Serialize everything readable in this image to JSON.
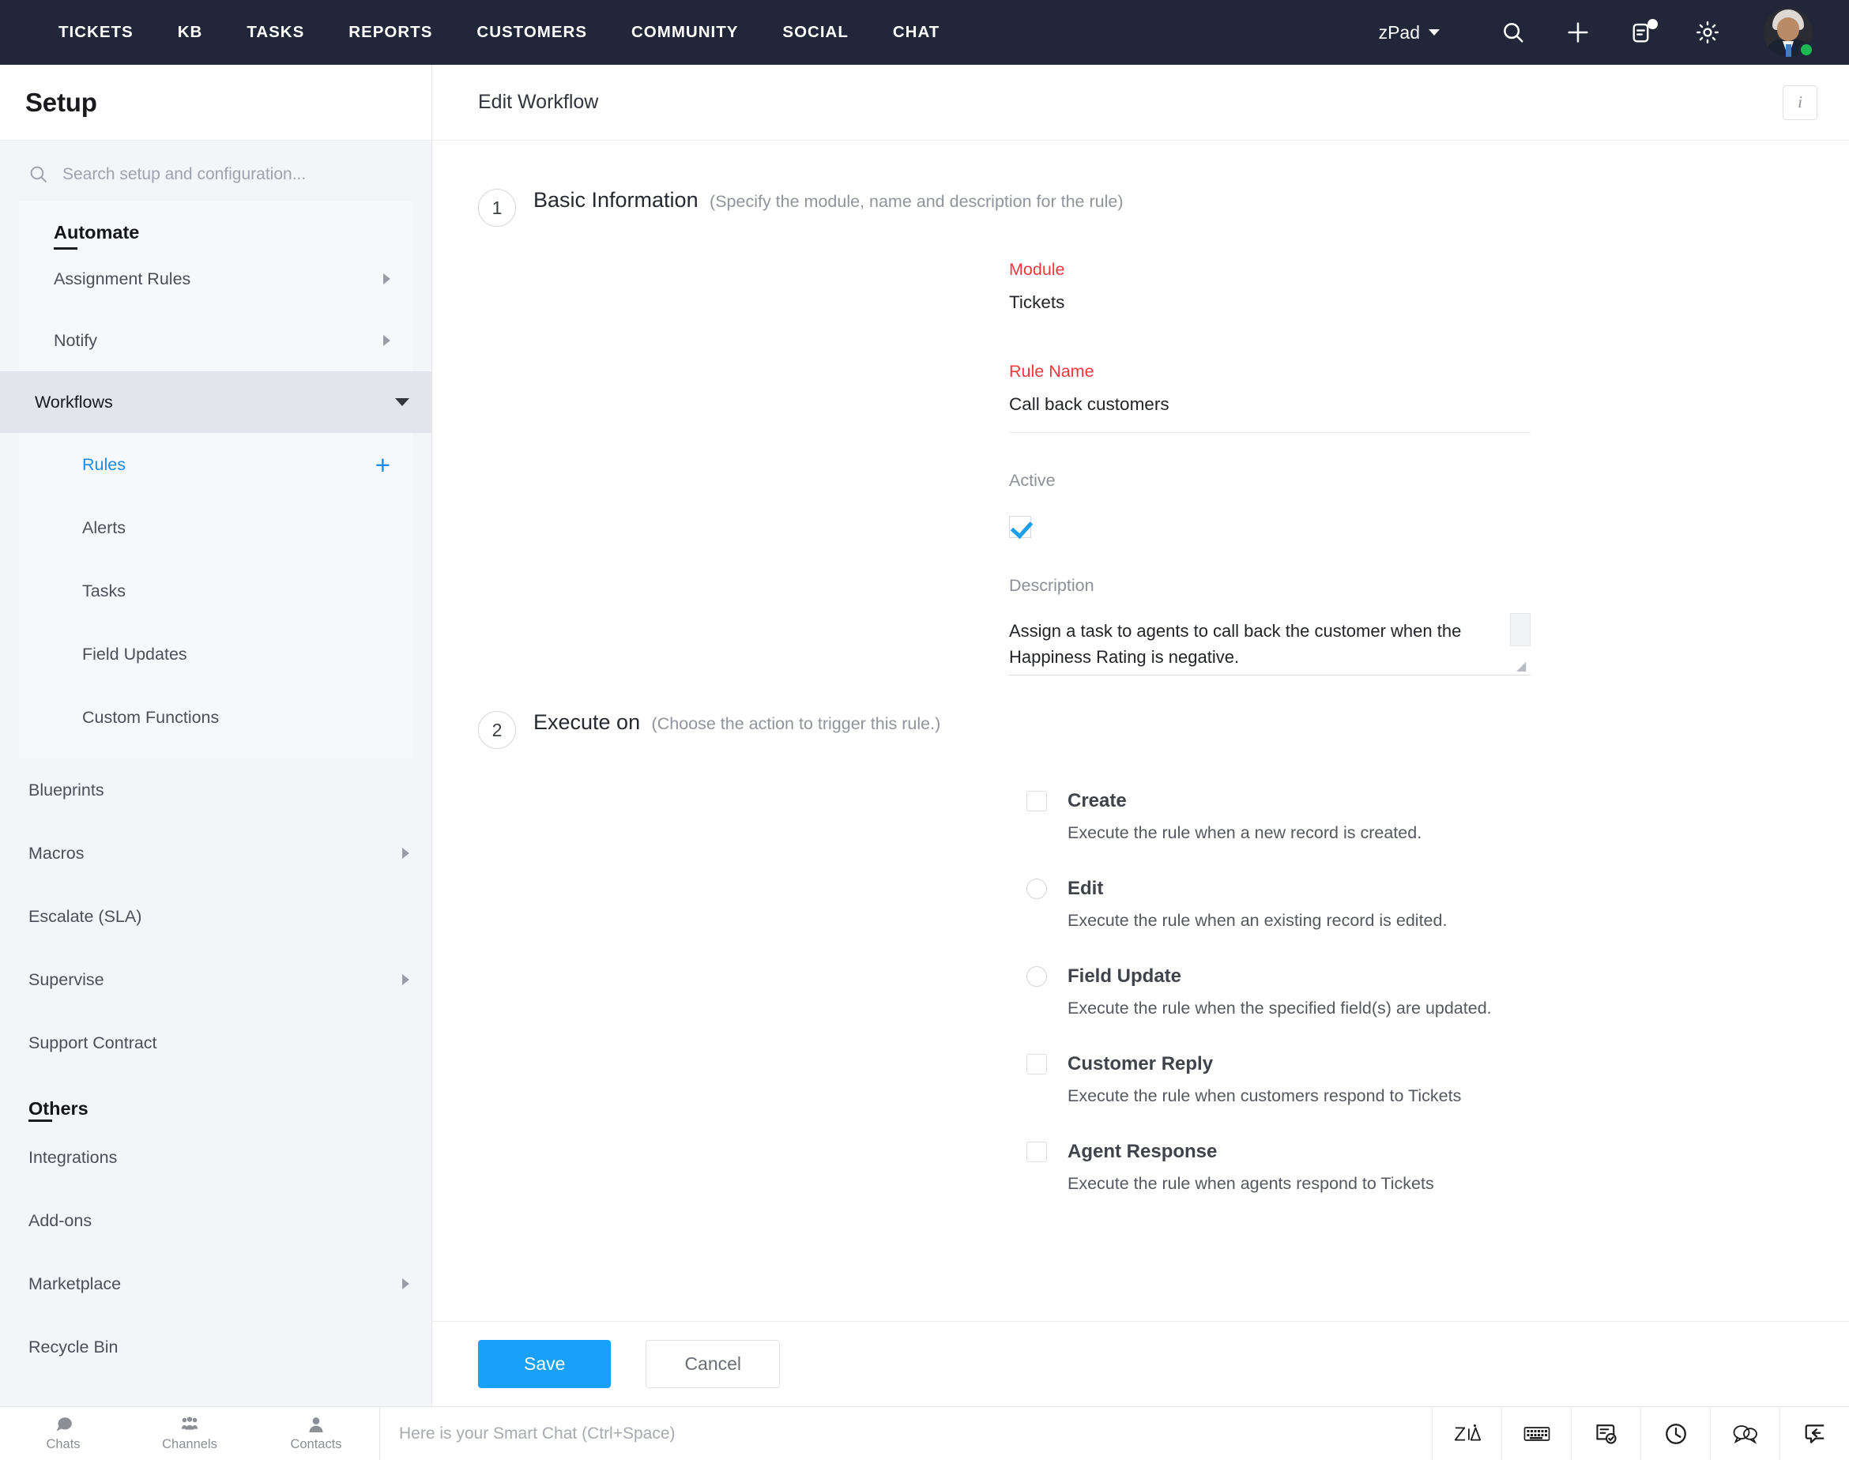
{
  "topnav": {
    "links": [
      {
        "label": "TICKETS",
        "name": "nav-tickets"
      },
      {
        "label": "KB",
        "name": "nav-kb"
      },
      {
        "label": "TASKS",
        "name": "nav-tasks"
      },
      {
        "label": "REPORTS",
        "name": "nav-reports"
      },
      {
        "label": "CUSTOMERS",
        "name": "nav-customers"
      },
      {
        "label": "COMMUNITY",
        "name": "nav-community"
      },
      {
        "label": "SOCIAL",
        "name": "nav-social"
      },
      {
        "label": "CHAT",
        "name": "nav-chat"
      }
    ],
    "portal_selector": "zPad",
    "icons": [
      "search-icon",
      "add-icon",
      "feed-icon",
      "settings-gear-icon",
      "user-avatar"
    ],
    "background_color": "#212738",
    "status_color": "#1db954"
  },
  "sidebar": {
    "title": "Setup",
    "search_placeholder": "Search setup and configuration...",
    "groups": [
      {
        "title": "Automate",
        "items": [
          {
            "label": "Assignment Rules",
            "has_arrow": true
          },
          {
            "label": "Notify",
            "has_arrow": true
          }
        ]
      }
    ],
    "active_item": {
      "label": "Workflows",
      "expanded": true
    },
    "sub_items": [
      {
        "label": "Rules",
        "selected": true,
        "has_plus": true
      },
      {
        "label": "Alerts",
        "selected": false,
        "has_plus": false
      },
      {
        "label": "Tasks",
        "selected": false,
        "has_plus": false
      },
      {
        "label": "Field Updates",
        "selected": false,
        "has_plus": false
      },
      {
        "label": "Custom Functions",
        "selected": false,
        "has_plus": false
      }
    ],
    "plain_items": [
      {
        "label": "Blueprints",
        "has_arrow": false
      },
      {
        "label": "Macros",
        "has_arrow": true
      },
      {
        "label": "Escalate (SLA)",
        "has_arrow": false
      },
      {
        "label": "Supervise",
        "has_arrow": true
      },
      {
        "label": "Support Contract",
        "has_arrow": false
      }
    ],
    "others_title": "Others",
    "others_items": [
      {
        "label": "Integrations",
        "has_arrow": false
      },
      {
        "label": "Add-ons",
        "has_arrow": false
      },
      {
        "label": "Marketplace",
        "has_arrow": true
      },
      {
        "label": "Recycle Bin",
        "has_arrow": false
      }
    ],
    "accent_color": "#1a8cf0",
    "active_row_color": "#e3e4ec"
  },
  "main": {
    "header_title": "Edit Workflow",
    "info_icon_label": "i",
    "step1": {
      "number": "1",
      "title": "Basic Information",
      "hint": "(Specify the module, name and description for the rule)",
      "module_label": "Module",
      "module_value": "Tickets",
      "rule_name_label": "Rule Name",
      "rule_name_value": "Call back customers",
      "active_label": "Active",
      "active_checked": true,
      "description_label": "Description",
      "description_value": "Assign a task to agents to call back the customer when the Happiness Rating is negative."
    },
    "step2": {
      "number": "2",
      "title": "Execute on",
      "hint": "(Choose the action to trigger this rule.)",
      "options": [
        {
          "name": "Create",
          "desc": "Execute the rule when a new record is created.",
          "control": "checkbox",
          "checked": false
        },
        {
          "name": "Edit",
          "desc": "Execute the rule when an existing record is edited.",
          "control": "radio",
          "checked": false
        },
        {
          "name": "Field Update",
          "desc": "Execute the rule when the specified field(s) are updated.",
          "control": "radio",
          "checked": false
        },
        {
          "name": "Customer Reply",
          "desc": "Execute the rule when customers respond to Tickets",
          "control": "checkbox",
          "checked": false
        },
        {
          "name": "Agent Response",
          "desc": "Execute the rule when agents respond to Tickets",
          "control": "checkbox",
          "checked": false
        }
      ]
    },
    "required_label_color": "#f0393f"
  },
  "actions": {
    "save_label": "Save",
    "cancel_label": "Cancel",
    "save_color": "#18a0fb"
  },
  "footer": {
    "tabs": [
      {
        "label": "Chats",
        "icon": "chat-bubbles-icon"
      },
      {
        "label": "Channels",
        "icon": "group-people-icon"
      },
      {
        "label": "Contacts",
        "icon": "person-icon"
      }
    ],
    "chat_placeholder": "Here is your Smart Chat (Ctrl+Space)",
    "right_icons": [
      "zia-logo-icon",
      "keyboard-icon",
      "task-checklist-icon",
      "clock-icon",
      "chat-bubbles-icon",
      "reply-icon"
    ]
  }
}
